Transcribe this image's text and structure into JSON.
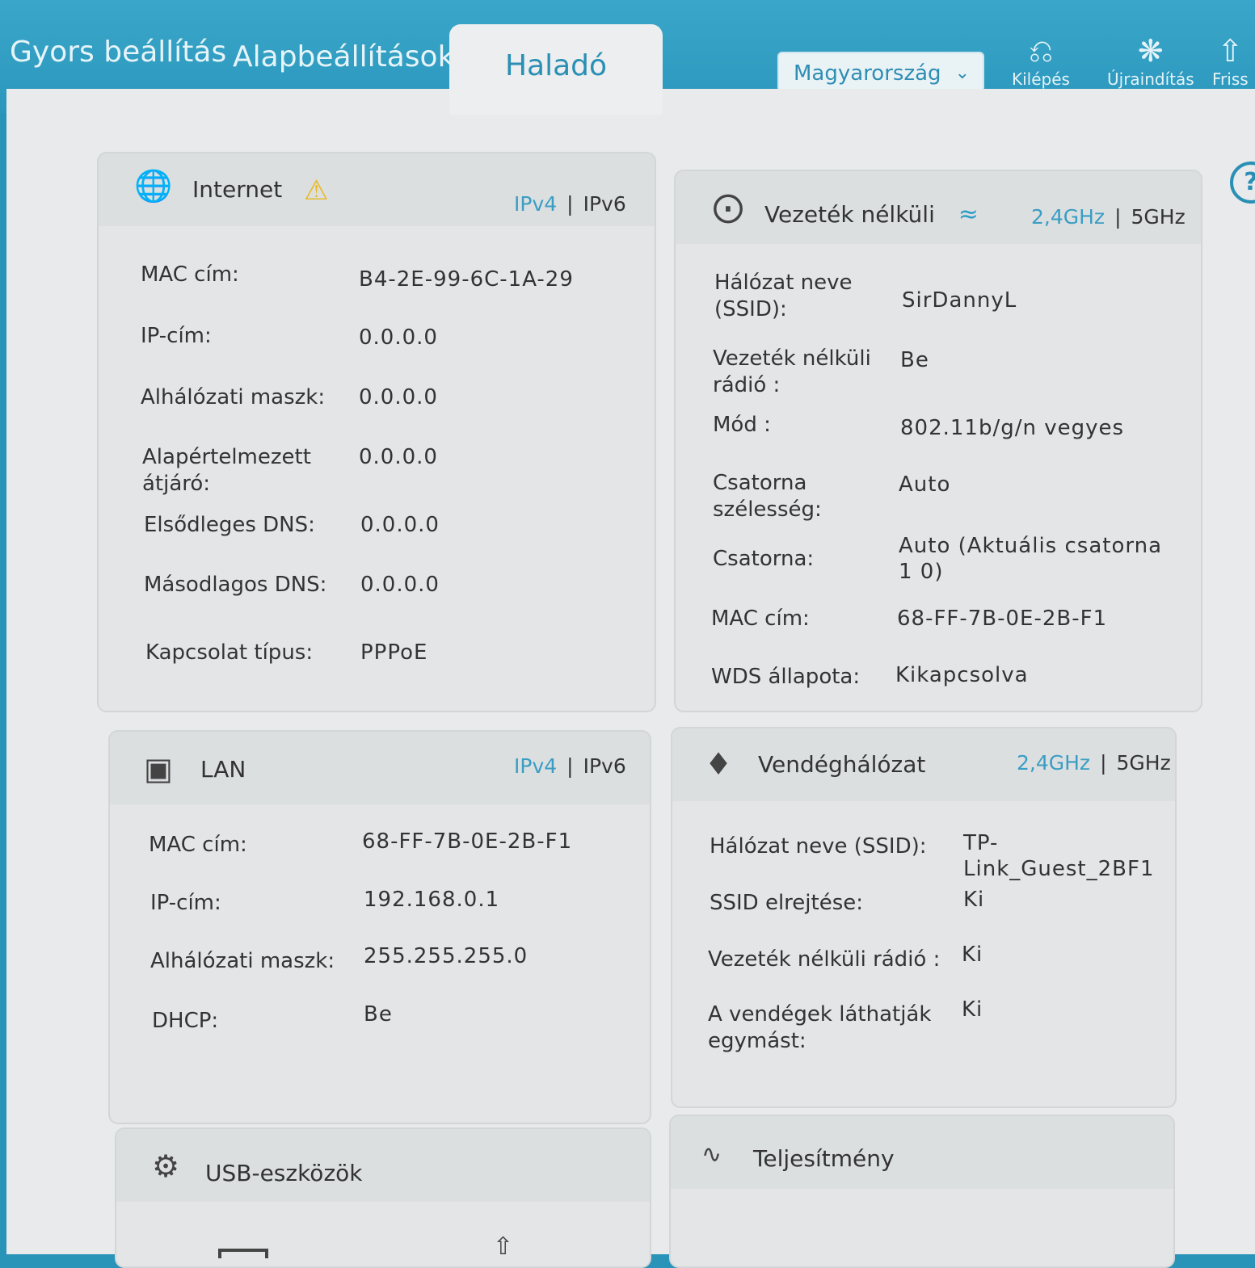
{
  "nav": {
    "quick_setup": "Gyors beállítás",
    "basic": "Alapbeállítások",
    "advanced": "Haladó"
  },
  "region": {
    "selected": "Magyarország"
  },
  "tools": {
    "logout": "Kilépés",
    "reboot": "Újraindítás",
    "refresh": "Friss"
  },
  "colors": {
    "accent": "#2a8fb5",
    "header": "#2b97bd",
    "warning": "#e8b81c"
  },
  "internet": {
    "title": "Internet",
    "ipv4": "IPv4",
    "sep": "|",
    "ipv6": "IPv6",
    "rows": [
      {
        "label": "MAC cím:",
        "value": "B4-2E-99-6C-1A-29"
      },
      {
        "label": "IP-cím:",
        "value": "0.0.0.0"
      },
      {
        "label": "Alhálózati maszk:",
        "value": "0.0.0.0"
      },
      {
        "label": "Alapértelmezett átjáró:",
        "value": "0.0.0.0"
      },
      {
        "label": "Elsődleges DNS:",
        "value": "0.0.0.0"
      },
      {
        "label": "Másodlagos DNS:",
        "value": "0.0.0.0"
      },
      {
        "label": "Kapcsolat típus:",
        "value": "PPPoE"
      }
    ]
  },
  "wireless": {
    "title": "Vezeték nélküli",
    "band24": "2,4GHz",
    "sep": "|",
    "band5": "5GHz",
    "rows": [
      {
        "label": "Hálózat neve (SSID):",
        "value": "SirDannyL"
      },
      {
        "label": "Vezeték nélküli rádió :",
        "value": "Be"
      },
      {
        "label": "Mód :",
        "value": "802.11b/g/n vegyes"
      },
      {
        "label": "Csatorna szélesség:",
        "value": "Auto"
      },
      {
        "label": "Csatorna:",
        "value": "Auto (Aktuális csatorna 1 0)"
      },
      {
        "label": "MAC cím:",
        "value": "68-FF-7B-0E-2B-F1"
      },
      {
        "label": "WDS állapota:",
        "value": "Kikapcsolva"
      }
    ]
  },
  "lan": {
    "title": "LAN",
    "ipv4": "IPv4",
    "sep": "|",
    "ipv6": "IPv6",
    "rows": [
      {
        "label": "MAC cím:",
        "value": "68-FF-7B-0E-2B-F1"
      },
      {
        "label": "IP-cím:",
        "value": "192.168.0.1"
      },
      {
        "label": "Alhálózati maszk:",
        "value": "255.255.255.0"
      },
      {
        "label": "DHCP:",
        "value": "Be"
      }
    ]
  },
  "guest": {
    "title": "Vendéghálózat",
    "band24": "2,4GHz",
    "sep": "|",
    "band5": "5GHz",
    "rows": [
      {
        "label": "Hálózat neve (SSID):",
        "value": "TP-Link_Guest_2BF1"
      },
      {
        "label": "SSID elrejtése:",
        "value": "Ki"
      },
      {
        "label": "Vezeték nélküli rádió :",
        "value": "Ki"
      },
      {
        "label": "A vendégek láthatják egymást:",
        "value": "Ki"
      }
    ]
  },
  "usb": {
    "title": "USB-eszközök"
  },
  "performance": {
    "title": "Teljesítmény"
  }
}
